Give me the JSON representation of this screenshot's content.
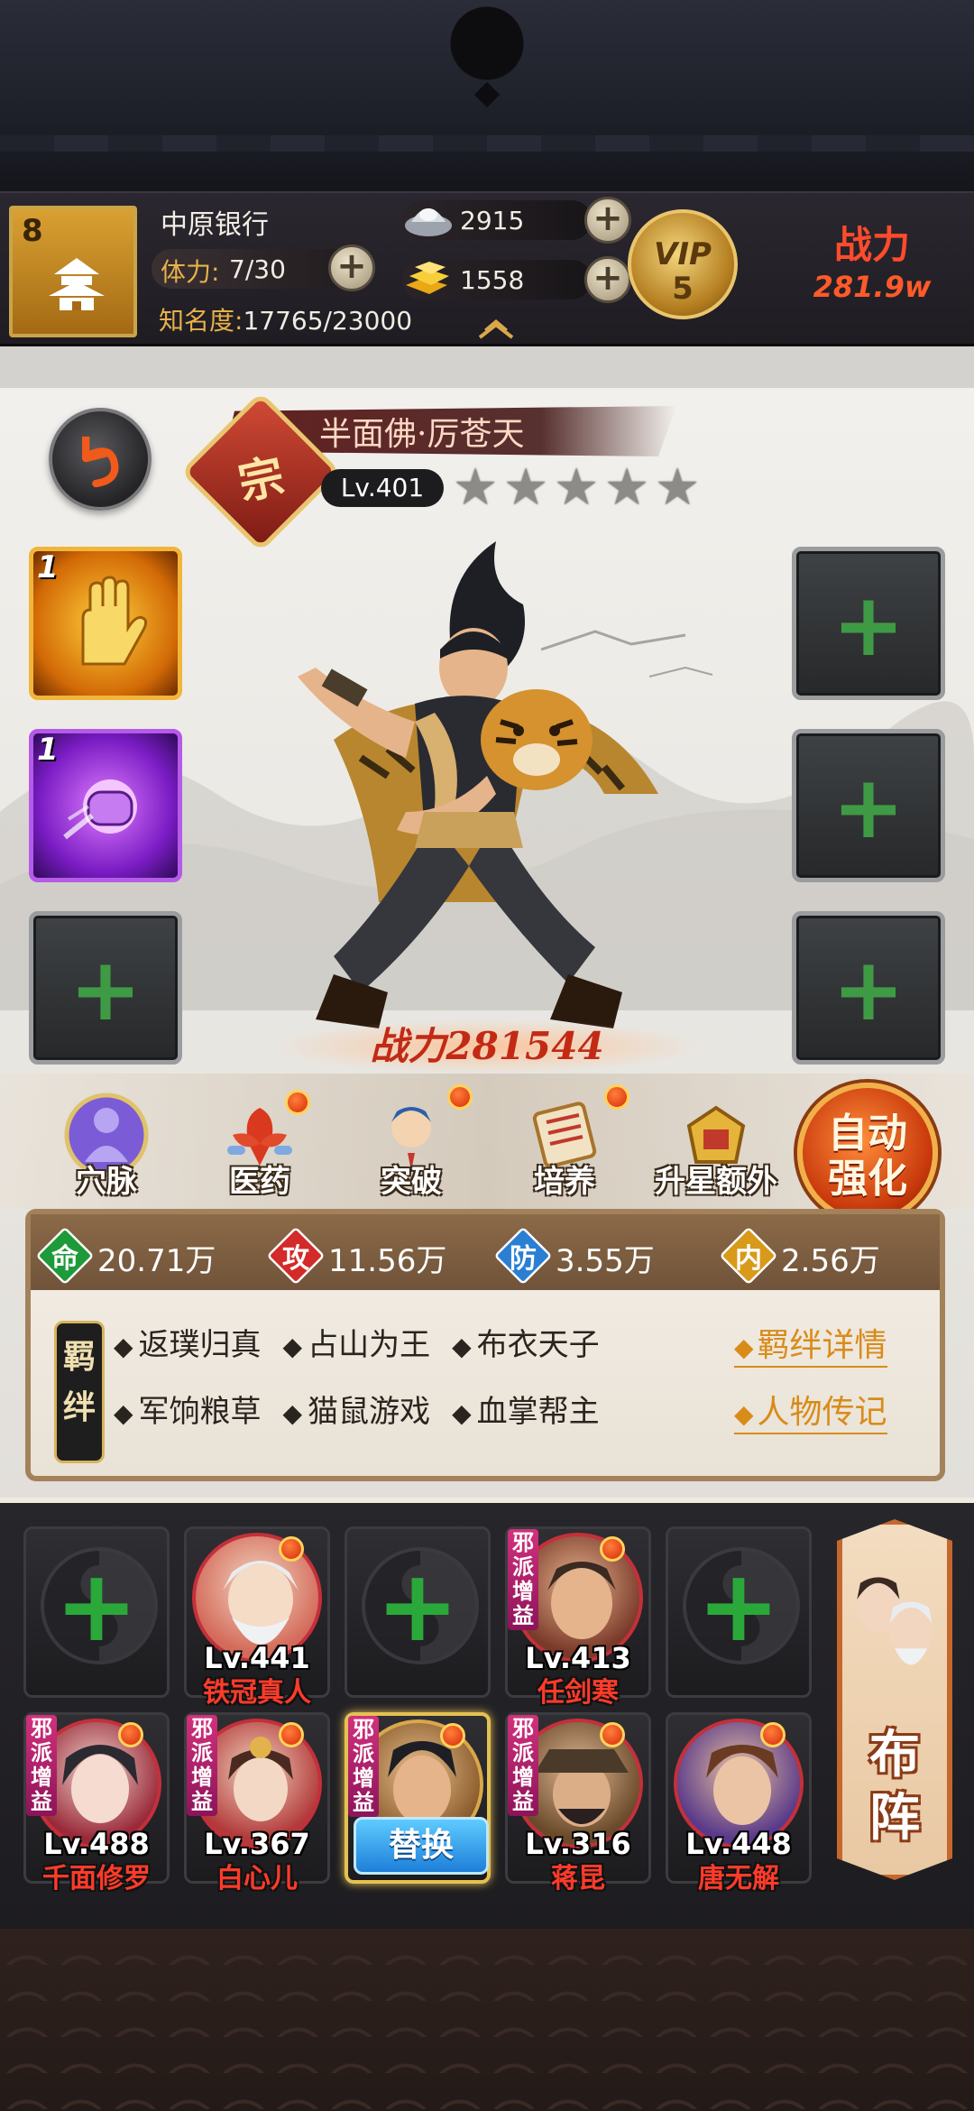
{
  "player": {
    "level": "8",
    "name": "中原银行",
    "stamina_label": "体力:",
    "stamina_value": "7/30",
    "fame_label": "知名度:",
    "fame_value": "17765/23000",
    "silver": "2915",
    "gold": "1558",
    "vip_text": "VIP",
    "vip_level": "5",
    "power_label": "战力",
    "power_value": "281.9w"
  },
  "hero": {
    "rank_seal": "宗",
    "name": "半面佛·厉苍天",
    "level": "Lv.401",
    "stars_filled": 0,
    "stars_total": 5,
    "power_text": "战力281544"
  },
  "skills": {
    "left": [
      {
        "level": "1",
        "icon": "golden-palm-icon"
      },
      {
        "level": "1",
        "icon": "purple-fist-icon"
      },
      {
        "level": "",
        "icon": "empty-slot"
      }
    ],
    "right": [
      {
        "icon": "empty-slot"
      },
      {
        "icon": "empty-slot"
      },
      {
        "icon": "empty-slot"
      }
    ]
  },
  "functions": [
    {
      "label": "穴脉",
      "icon": "meridian-icon",
      "dot": false
    },
    {
      "label": "医药",
      "icon": "medicine-icon",
      "dot": true
    },
    {
      "label": "突破",
      "icon": "breakthrough-icon",
      "dot": true
    },
    {
      "label": "培养",
      "icon": "cultivate-icon",
      "dot": true
    },
    {
      "label": "升星额外",
      "icon": "star-upgrade-icon",
      "dot": false
    }
  ],
  "auto_button": "自动强化",
  "stats": [
    {
      "icon_text": "命",
      "value": "20.71万",
      "color": "#1e9a3a"
    },
    {
      "icon_text": "攻",
      "value": "11.56万",
      "color": "#d32a2a"
    },
    {
      "icon_text": "防",
      "value": "3.55万",
      "color": "#2a7fd3"
    },
    {
      "icon_text": "内",
      "value": "2.56万",
      "color": "#d89a1a"
    }
  ],
  "bond": {
    "tag": "羁绊",
    "rows": [
      [
        "返璞归真",
        "占山为王",
        "布衣天子"
      ],
      [
        "军饷粮草",
        "猫鼠游戏",
        "血掌帮主"
      ]
    ],
    "detail_link": "羁绊详情",
    "bio_link": "人物传记"
  },
  "team": {
    "row1": [
      {
        "empty": true
      },
      {
        "level": "Lv.441",
        "name": "铁冠真人",
        "evil": false
      },
      {
        "empty": true
      },
      {
        "level": "Lv.413",
        "name": "任剑寒",
        "evil": true
      },
      {
        "empty": true
      }
    ],
    "row2": [
      {
        "level": "Lv.488",
        "name": "千面修罗",
        "evil": true
      },
      {
        "level": "Lv.367",
        "name": "白心儿",
        "evil": true
      },
      {
        "selected": true,
        "evil": true,
        "button": "替换"
      },
      {
        "level": "Lv.316",
        "name": "蒋昆",
        "evil": true
      },
      {
        "level": "Lv.448",
        "name": "唐无解",
        "evil": false
      }
    ],
    "evil_tag": "邪派增益"
  },
  "formation_button": "布阵",
  "colors": {
    "accent_gold": "#e9c56d",
    "power_red": "#ff4b2b",
    "plus_green": "#3f9a45",
    "link_orange": "#d98b1a"
  }
}
